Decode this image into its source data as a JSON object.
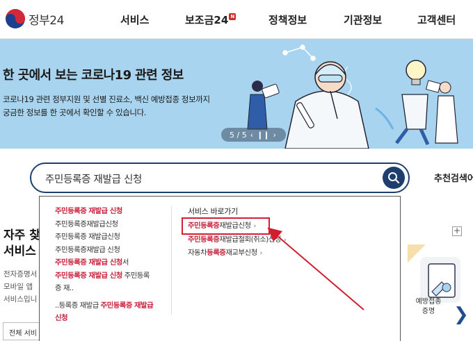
{
  "header": {
    "logo_text": "정부24",
    "nav": [
      {
        "label": "서비스"
      },
      {
        "label": "보조금24",
        "badge": "N"
      },
      {
        "label": "정책정보"
      },
      {
        "label": "기관정보"
      },
      {
        "label": "고객센터"
      }
    ]
  },
  "banner": {
    "title": "한 곳에서 보는 코로나19 관련 정보",
    "desc_line1": "코로나19 관련 정부지원 및 선별 진료소, 백신 예방접종 정보까지",
    "desc_line2": "궁금한 정보를 한 곳에서 확인할 수 있습니다.",
    "pager": "5 / 5",
    "prev_icon": "chevron-left-icon",
    "pause_icon": "pause-icon",
    "next_icon": "chevron-right-icon"
  },
  "search": {
    "value": "주민등록증 재발급 신청",
    "icon": "search-icon",
    "recommend_label": "추천검색어"
  },
  "left_section": {
    "title_line1": "자주 찾",
    "title_line2": "서비스",
    "desc_line1": "전자증명서",
    "desc_line2": "모바일 앱",
    "desc_line3": "서비스입니",
    "select_value": "전체 서비"
  },
  "right_section": {
    "plus": "+",
    "card_label_line1": "예방접종",
    "card_label_line2": "증명",
    "next": "❯"
  },
  "dropdown": {
    "suggestions": [
      {
        "hl": "주민등록증 재발급 신청",
        "rest": ""
      },
      {
        "hl": "",
        "rest": "주민등록증재발급신청"
      },
      {
        "hl": "",
        "rest": "주민등록증 재발급신청"
      },
      {
        "hl": "",
        "rest": "주민등록증재발급 신청"
      },
      {
        "hl": "주민등록증 재발급 신청",
        "rest": "서"
      },
      {
        "hl": "주민등록증 재발급 신청",
        "rest": " 주민등록"
      },
      {
        "hl": "",
        "rest": "증 재.."
      },
      {
        "pre": "..등록증 재발급 ",
        "hl": "주민등록증 재발급"
      },
      {
        "hl": "신청",
        "rest": ""
      }
    ],
    "services_head": "서비스 바로가기",
    "services": [
      {
        "hl": "주민등록증",
        "rest": "재발급신청"
      },
      {
        "hl": "주민등록증",
        "rest": "재발급철회(취소)신청"
      },
      {
        "pre": "자동차",
        "hl": "등록증",
        "rest": "재교부신청"
      }
    ]
  },
  "colors": {
    "accent_navy": "#1e3f6e",
    "highlight_red": "#c8203a",
    "banner_bg": "#a9d4ef"
  }
}
